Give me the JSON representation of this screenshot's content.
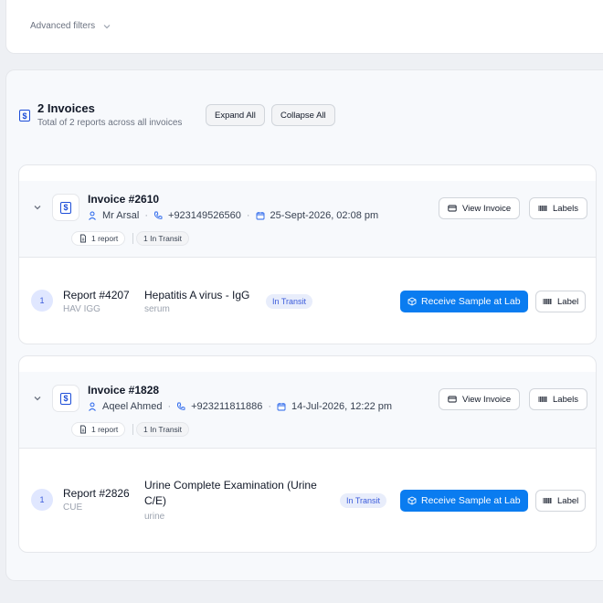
{
  "filters": {
    "advanced_label": "Advanced filters"
  },
  "summary": {
    "title": "2 Invoices",
    "subtitle": "Total of 2 reports across all invoices",
    "expand_label": "Expand All",
    "collapse_label": "Collapse All"
  },
  "invoices": [
    {
      "number": "Invoice #2610",
      "patient": "Mr Arsal",
      "phone": "+923149526560",
      "date": "25-Sept-2026, 02:08 pm",
      "reports_tag": "1 report",
      "transit_tag": "1 In Transit",
      "view_label": "View Invoice",
      "labels_label": "Labels",
      "reports": [
        {
          "index": "1",
          "report_no": "Report #4207",
          "code": "HAV IGG",
          "test": "Hepatitis A virus - IgG",
          "sample": "serum",
          "status": "In Transit",
          "receive_label": "Receive Sample at Lab",
          "label_label": "Label"
        }
      ]
    },
    {
      "number": "Invoice #1828",
      "patient": "Aqeel Ahmed",
      "phone": "+923211811886",
      "date": "14-Jul-2026, 12:22 pm",
      "reports_tag": "1 report",
      "transit_tag": "1 In Transit",
      "view_label": "View Invoice",
      "labels_label": "Labels",
      "reports": [
        {
          "index": "1",
          "report_no": "Report #2826",
          "code": "CUE",
          "test": "Urine Complete Examination (Urine C/E)",
          "sample": "urine",
          "status": "In Transit",
          "receive_label": "Receive Sample at Lab",
          "label_label": "Label"
        }
      ]
    }
  ],
  "colors": {
    "primary": "#0a7cf0",
    "accent_blue": "#1d4ed8",
    "pill_bg": "#e8edfb"
  }
}
